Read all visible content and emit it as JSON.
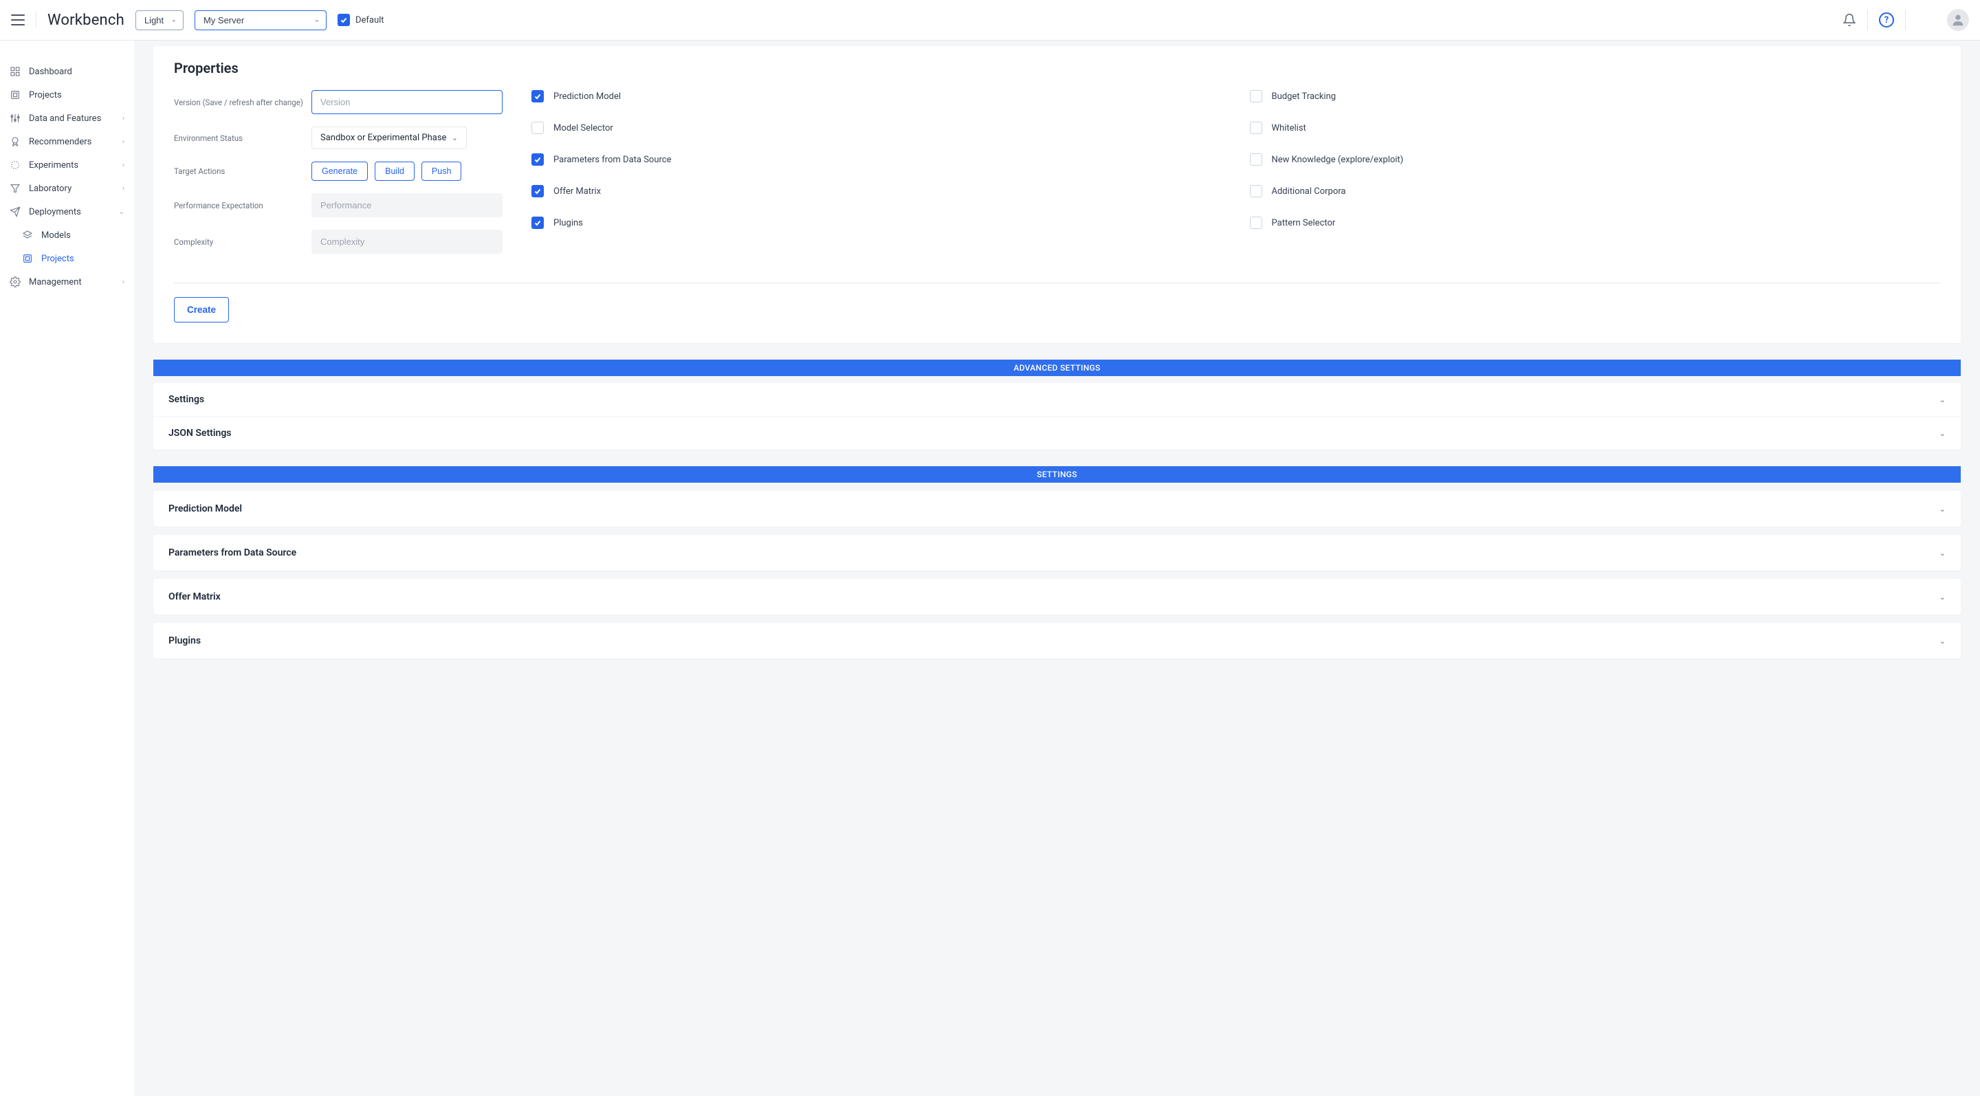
{
  "header": {
    "brand": "Workbench",
    "theme_selected": "Light",
    "server_selected": "My Server",
    "default_label": "Default",
    "default_checked": true
  },
  "sidebar": {
    "items": [
      {
        "label": "Dashboard",
        "icon": "grid",
        "expandable": false
      },
      {
        "label": "Projects",
        "icon": "projects",
        "expandable": false
      },
      {
        "label": "Data and Features",
        "icon": "sliders",
        "expandable": true
      },
      {
        "label": "Recommenders",
        "icon": "ribbon",
        "expandable": true
      },
      {
        "label": "Experiments",
        "icon": "spinner",
        "expandable": true
      },
      {
        "label": "Laboratory",
        "icon": "filter",
        "expandable": true
      },
      {
        "label": "Deployments",
        "icon": "send",
        "expandable": true,
        "expanded": true,
        "children": [
          {
            "label": "Models",
            "icon": "models"
          },
          {
            "label": "Projects",
            "icon": "projects",
            "active": true
          }
        ]
      },
      {
        "label": "Management",
        "icon": "gear",
        "expandable": true
      }
    ]
  },
  "properties": {
    "title": "Properties",
    "fields": {
      "version_label": "Version (Save / refresh after change)",
      "version_placeholder": "Version",
      "env_label": "Environment Status",
      "env_value": "Sandbox or Experimental Phase",
      "target_label": "Target Actions",
      "perf_label": "Performance Expectation",
      "perf_placeholder": "Performance",
      "complexity_label": "Complexity",
      "complexity_placeholder": "Complexity"
    },
    "buttons": {
      "generate": "Generate",
      "build": "Build",
      "push": "Push",
      "create": "Create"
    },
    "checkboxes": [
      {
        "label": "Prediction Model",
        "checked": true
      },
      {
        "label": "Budget Tracking",
        "checked": false
      },
      {
        "label": "Model Selector",
        "checked": false
      },
      {
        "label": "Whitelist",
        "checked": false
      },
      {
        "label": "Parameters from Data Source",
        "checked": true
      },
      {
        "label": "New Knowledge (explore/exploit)",
        "checked": false
      },
      {
        "label": "Offer Matrix",
        "checked": true
      },
      {
        "label": "Additional Corpora",
        "checked": false
      },
      {
        "label": "Plugins",
        "checked": true
      },
      {
        "label": "Pattern Selector",
        "checked": false
      }
    ]
  },
  "sections": {
    "advanced_title": "ADVANCED SETTINGS",
    "advanced_items": [
      "Settings",
      "JSON Settings"
    ],
    "settings_title": "SETTINGS",
    "settings_items": [
      "Prediction Model",
      "Parameters from Data Source",
      "Offer Matrix",
      "Plugins"
    ]
  }
}
